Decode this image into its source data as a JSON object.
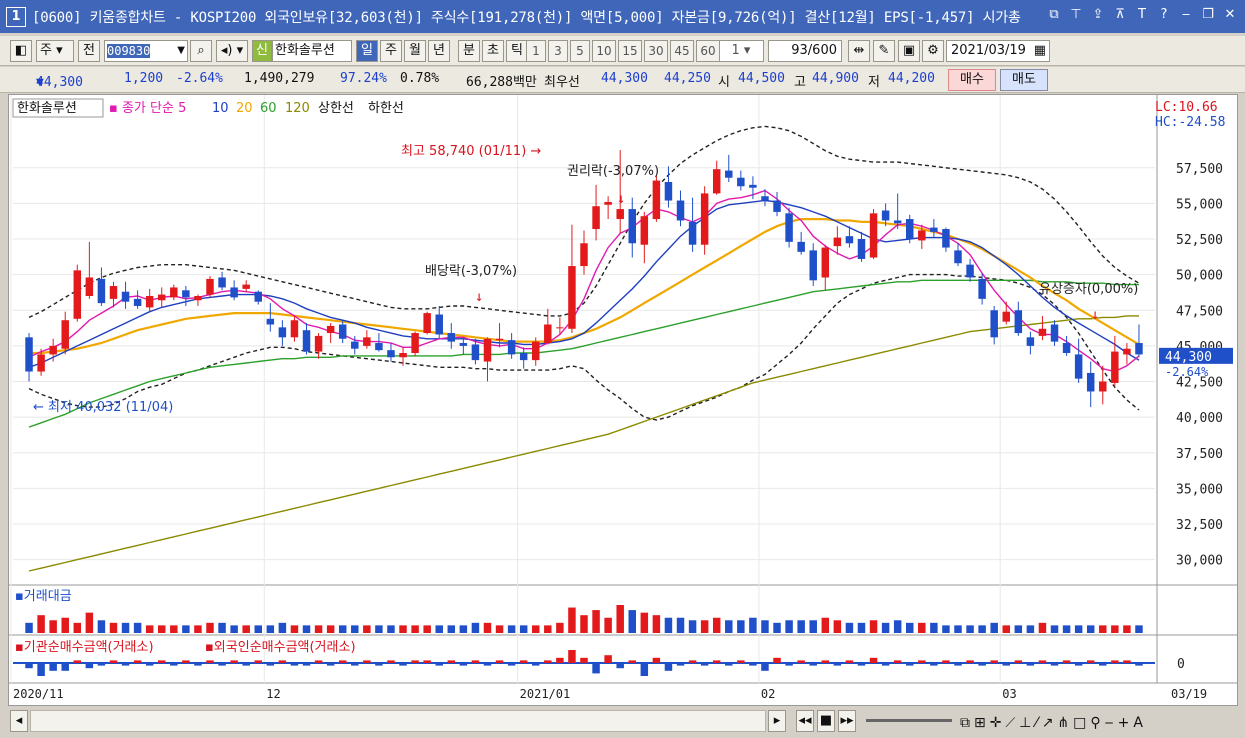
{
  "window": {
    "num": "1",
    "title": "[0600] 키움종합차트 - KOSPI200 외국인보유[32,603(천)] 주식수[191,278(천)] 액면[5,000] 자본금[9,726(억)] 결산[12월] EPS[-1,457] 시가총"
  },
  "toolbar": {
    "type1": "주",
    "type2": "전",
    "code": "009830",
    "name": "한화솔루션",
    "sin": "신",
    "periods": [
      "일",
      "주",
      "월",
      "년",
      "분",
      "초",
      "틱"
    ],
    "nums": [
      "1",
      "3",
      "5",
      "10",
      "15",
      "30",
      "45",
      "60"
    ],
    "unit": "1",
    "count": "93/600",
    "date": "2021/03/19"
  },
  "quote": {
    "price": "44,300",
    "arrow": "▼",
    "change": "1,200",
    "rate": "-2.64%",
    "volume": "1,490,279",
    "ratio": "97.24%",
    "turnover": "0.78%",
    "amount": "66,288백만",
    "best_label": "최우선",
    "ask": "44,300",
    "bid": "44,250",
    "open_label": "시",
    "open": "44,500",
    "high_label": "고",
    "high": "44,900",
    "low_label": "저",
    "low": "44,200",
    "buy": "매수",
    "sell": "매도"
  },
  "legend": {
    "name": "한화솔루션",
    "ma_label": "종가 단순",
    "ma": [
      "5",
      "10",
      "20",
      "60",
      "120"
    ],
    "upper": "상한선",
    "lower": "하한선"
  },
  "chart_data": {
    "type": "candlestick",
    "xlabels": [
      "2020/11",
      "12",
      "2021/01",
      "02",
      "03",
      "03/19"
    ],
    "yticks": [
      30000,
      32500,
      35000,
      37500,
      40000,
      42500,
      45000,
      47500,
      50000,
      52500,
      55000,
      57500
    ],
    "ylim": [
      28500,
      60500
    ],
    "lc": "LC:10.66",
    "hc": "HC:-24.58",
    "price_tag": "44,300",
    "rate_tag": "-2.64%",
    "annotations": {
      "high": "최고 58,740 (01/11)",
      "low": "최저 40,032 (11/04)",
      "div": "배당락(-3,07%)",
      "rights": "권리락(-3,07%)",
      "capinc": "유상증자(0,00%)"
    },
    "candles": [
      [
        45600,
        45900,
        42500,
        43200
      ],
      [
        43200,
        44800,
        42900,
        44400
      ],
      [
        44400,
        45500,
        43900,
        45000
      ],
      [
        44800,
        47400,
        44400,
        46800
      ],
      [
        46900,
        50700,
        46700,
        50300
      ],
      [
        48500,
        52300,
        48300,
        49800
      ],
      [
        49700,
        50500,
        47800,
        48000
      ],
      [
        48300,
        49500,
        47700,
        49200
      ],
      [
        48800,
        49500,
        47600,
        48100
      ],
      [
        48300,
        48900,
        47600,
        47800
      ],
      [
        47700,
        49000,
        47400,
        48500
      ],
      [
        48200,
        49100,
        47700,
        48600
      ],
      [
        48400,
        49300,
        48200,
        49100
      ],
      [
        48900,
        49200,
        47800,
        48400
      ],
      [
        48200,
        48600,
        47800,
        48500
      ],
      [
        48600,
        49900,
        48400,
        49700
      ],
      [
        49800,
        50200,
        48900,
        49100
      ],
      [
        49100,
        49600,
        48200,
        48400
      ],
      [
        49000,
        49600,
        48800,
        49300
      ],
      [
        48800,
        48900,
        47900,
        48100
      ],
      [
        46900,
        48000,
        46000,
        46500
      ],
      [
        46300,
        46800,
        45000,
        45600
      ],
      [
        45600,
        47100,
        45300,
        46800
      ],
      [
        46100,
        46600,
        44400,
        44600
      ],
      [
        44600,
        45900,
        44100,
        45700
      ],
      [
        45900,
        46600,
        45200,
        46400
      ],
      [
        46500,
        46800,
        45200,
        45500
      ],
      [
        45300,
        45700,
        44400,
        44800
      ],
      [
        45000,
        46100,
        44800,
        45600
      ],
      [
        45200,
        45900,
        44600,
        44700
      ],
      [
        44700,
        45200,
        43900,
        44200
      ],
      [
        44200,
        44900,
        43600,
        44500
      ],
      [
        44500,
        46000,
        44300,
        45900
      ],
      [
        45900,
        47400,
        45800,
        47300
      ],
      [
        47200,
        47800,
        45500,
        45800
      ],
      [
        45900,
        46600,
        44800,
        45300
      ],
      [
        45200,
        45600,
        44400,
        45000
      ],
      [
        45100,
        45500,
        43700,
        44000
      ],
      [
        43900,
        45600,
        42500,
        45500
      ],
      [
        45400,
        46600,
        44900,
        45500
      ],
      [
        45400,
        45900,
        44100,
        44400
      ],
      [
        44500,
        44900,
        43400,
        44000
      ],
      [
        44000,
        45600,
        43600,
        45300
      ],
      [
        45200,
        47600,
        45100,
        46500
      ],
      [
        46300,
        47000,
        45800,
        46300
      ],
      [
        46200,
        53500,
        45900,
        50600
      ],
      [
        50600,
        53100,
        50000,
        52200
      ],
      [
        53200,
        56300,
        52400,
        54800
      ],
      [
        54900,
        55500,
        53900,
        55100
      ],
      [
        53900,
        58740,
        52900,
        54600
      ],
      [
        54600,
        55400,
        51200,
        52200
      ],
      [
        52100,
        54400,
        50800,
        54100
      ],
      [
        53900,
        57000,
        53700,
        56600
      ],
      [
        56500,
        57600,
        54700,
        55200
      ],
      [
        55200,
        55900,
        53400,
        53800
      ],
      [
        53700,
        55400,
        51600,
        52100
      ],
      [
        52100,
        56200,
        51400,
        55700
      ],
      [
        55700,
        58000,
        55600,
        57400
      ],
      [
        57300,
        58400,
        56500,
        56800
      ],
      [
        56800,
        57300,
        55900,
        56200
      ],
      [
        56300,
        56900,
        55300,
        56100
      ],
      [
        55500,
        56000,
        54800,
        55200
      ],
      [
        55200,
        55800,
        54100,
        54400
      ],
      [
        54300,
        54700,
        51900,
        52300
      ],
      [
        52300,
        53000,
        51400,
        51600
      ],
      [
        51700,
        52200,
        49200,
        49600
      ],
      [
        49800,
        52100,
        48900,
        51900
      ],
      [
        52000,
        53400,
        51400,
        52600
      ],
      [
        52700,
        53400,
        51900,
        52200
      ],
      [
        52500,
        53000,
        50900,
        51100
      ],
      [
        51200,
        54600,
        51100,
        54300
      ],
      [
        54500,
        55000,
        53400,
        53800
      ],
      [
        53800,
        55700,
        53200,
        53600
      ],
      [
        53900,
        54200,
        52200,
        52500
      ],
      [
        52400,
        53500,
        51800,
        53100
      ],
      [
        53300,
        53900,
        52600,
        53000
      ],
      [
        53200,
        53300,
        51600,
        51900
      ],
      [
        51700,
        52200,
        50600,
        50800
      ],
      [
        50700,
        51100,
        49500,
        49800
      ],
      [
        49700,
        50100,
        47900,
        48300
      ],
      [
        47500,
        47800,
        45100,
        45600
      ],
      [
        46700,
        48100,
        46500,
        47400
      ],
      [
        47500,
        48100,
        45700,
        45900
      ],
      [
        45600,
        46000,
        44400,
        45000
      ],
      [
        45700,
        47100,
        45400,
        46200
      ],
      [
        46500,
        46800,
        45000,
        45300
      ],
      [
        45200,
        45700,
        44300,
        44500
      ],
      [
        44400,
        45500,
        42400,
        42700
      ],
      [
        43100,
        43900,
        40700,
        41800
      ],
      [
        41800,
        43600,
        40900,
        42500
      ],
      [
        42400,
        45700,
        42200,
        44600
      ],
      [
        44400,
        45200,
        43700,
        44800
      ],
      [
        45200,
        46500,
        44200,
        44400
      ]
    ],
    "ma5": [
      44200,
      44600,
      44900,
      45300,
      46000,
      46800,
      47300,
      47800,
      48400,
      48500,
      48200,
      48400,
      48500,
      48300,
      48400,
      48600,
      48800,
      48900,
      48800,
      48700,
      48300,
      47600,
      47100,
      46500,
      46300,
      46000,
      45800,
      45400,
      45300,
      45300,
      45200,
      44900,
      44900,
      45200,
      45500,
      45600,
      45600,
      45300,
      45100,
      45000,
      45100,
      44800,
      44800,
      45200,
      45800,
      46800,
      48300,
      50300,
      51900,
      52900,
      53300,
      54000,
      54600,
      54400,
      54000,
      53700,
      54100,
      55000,
      55300,
      55400,
      55600,
      55900,
      55300,
      54500,
      53800,
      52700,
      52000,
      51500,
      51100,
      51400,
      52000,
      52800,
      53500,
      53600,
      53400,
      53100,
      52700,
      52200,
      51400,
      50100,
      48900,
      47900,
      47000,
      46200,
      45800,
      45800,
      45300,
      44700,
      44100,
      43400,
      43200,
      43600,
      44300
    ],
    "ma10": [
      43500,
      43800,
      44200,
      44600,
      45000,
      45400,
      45800,
      46200,
      46600,
      47000,
      47400,
      47700,
      47900,
      48100,
      48300,
      48400,
      48500,
      48600,
      48600,
      48600,
      48500,
      48300,
      48000,
      47600,
      47300,
      47000,
      46800,
      46600,
      46300,
      46100,
      45900,
      45700,
      45600,
      45500,
      45500,
      45500,
      45500,
      45400,
      45300,
      45200,
      45200,
      45100,
      45100,
      45200,
      45300,
      45500,
      45900,
      46600,
      47400,
      48200,
      49000,
      49900,
      50900,
      51800,
      52700,
      53400,
      54000,
      54600,
      54900,
      55000,
      55100,
      55200,
      55100,
      54900,
      54700,
      54400,
      54100,
      53700,
      53300,
      52900,
      52500,
      52300,
      52400,
      52500,
      52600,
      52600,
      52600,
      52500,
      52300,
      51900,
      51300,
      50700,
      50000,
      49200,
      48400,
      47700,
      47100,
      46600,
      46100,
      45600,
      45100,
      44500,
      44000
    ],
    "ma20": [
      44500,
      44500,
      44600,
      44700,
      44800,
      45000,
      45200,
      45500,
      45800,
      46100,
      46300,
      46500,
      46700,
      46900,
      47000,
      47100,
      47200,
      47300,
      47300,
      47300,
      47300,
      47200,
      47100,
      47000,
      46900,
      46800,
      46700,
      46600,
      46500,
      46400,
      46300,
      46200,
      46100,
      46000,
      45900,
      45800,
      45700,
      45600,
      45500,
      45400,
      45300,
      45300,
      45300,
      45300,
      45400,
      45600,
      45900,
      46200,
      46600,
      47000,
      47500,
      48000,
      48500,
      49000,
      49500,
      50000,
      50500,
      51000,
      51500,
      52000,
      52500,
      53000,
      53400,
      53700,
      53900,
      53900,
      53900,
      53800,
      53800,
      53700,
      53700,
      53600,
      53500,
      53400,
      53200,
      53000,
      52800,
      52500,
      52200,
      51800,
      51300,
      50800,
      50300,
      49800,
      49200,
      48700,
      48200,
      47600,
      47100,
      46600,
      46100,
      45600,
      45100
    ],
    "ma60": [
      39300,
      39600,
      39900,
      40200,
      40600,
      41000,
      41300,
      41600,
      41900,
      42200,
      42500,
      42700,
      42900,
      43100,
      43300,
      43500,
      43600,
      43700,
      43800,
      43900,
      44000,
      44100,
      44100,
      44200,
      44200,
      44200,
      44300,
      44300,
      44300,
      44300,
      44300,
      44300,
      44300,
      44300,
      44300,
      44300,
      44400,
      44400,
      44400,
      44400,
      44500,
      44500,
      44500,
      44600,
      44700,
      44800,
      45000,
      45200,
      45400,
      45600,
      45800,
      46000,
      46200,
      46400,
      46600,
      46800,
      47000,
      47200,
      47400,
      47600,
      47800,
      48000,
      48200,
      48400,
      48600,
      48800,
      48900,
      49000,
      49100,
      49200,
      49300,
      49400,
      49500,
      49500,
      49600,
      49600,
      49600,
      49600,
      49600,
      49600,
      49600,
      49600,
      49600,
      49600,
      49500,
      49500,
      49500,
      49400,
      49400,
      49400,
      49300,
      49300,
      49300
    ],
    "ma120": [
      29200,
      29400,
      29600,
      29800,
      30000,
      30200,
      30400,
      30600,
      30800,
      31000,
      31200,
      31400,
      31600,
      31800,
      32000,
      32200,
      32400,
      32600,
      32800,
      33000,
      33200,
      33400,
      33600,
      33800,
      34000,
      34200,
      34400,
      34600,
      34800,
      35000,
      35200,
      35400,
      35600,
      35800,
      36000,
      36200,
      36400,
      36600,
      36800,
      37000,
      37200,
      37400,
      37600,
      37800,
      38000,
      38200,
      38400,
      38600,
      38800,
      39100,
      39400,
      39700,
      40000,
      40300,
      40600,
      40900,
      41200,
      41500,
      41800,
      42100,
      42400,
      42600,
      42800,
      43000,
      43200,
      43400,
      43600,
      43800,
      44000,
      44200,
      44400,
      44600,
      44800,
      45000,
      45200,
      45400,
      45600,
      45800,
      46000,
      46100,
      46200,
      46300,
      46400,
      46500,
      46600,
      46700,
      46800,
      46900,
      46900,
      47000,
      47000,
      47100,
      47100
    ],
    "upper": [
      47000,
      47400,
      47900,
      48400,
      48900,
      49400,
      49800,
      50100,
      50300,
      50500,
      50600,
      50700,
      50700,
      50700,
      50600,
      50500,
      50400,
      50300,
      50100,
      49900,
      49700,
      49500,
      49300,
      49100,
      48900,
      48700,
      48500,
      48300,
      48100,
      47900,
      47700,
      47600,
      47600,
      47600,
      47700,
      47800,
      47800,
      47700,
      47600,
      47500,
      47400,
      47300,
      47200,
      47100,
      47100,
      47300,
      48000,
      49200,
      50700,
      52200,
      53700,
      55000,
      56100,
      57000,
      57800,
      58400,
      58900,
      59400,
      59800,
      60100,
      60300,
      60400,
      60300,
      60100,
      59700,
      59200,
      58700,
      58300,
      58100,
      58000,
      57900,
      57900,
      57900,
      57800,
      57700,
      57600,
      57500,
      57400,
      57300,
      57200,
      57100,
      57000,
      56800,
      56500,
      56000,
      55300,
      54400,
      53400,
      52300,
      51300,
      50500,
      49900,
      49400
    ],
    "lower": [
      42000,
      41600,
      41300,
      41000,
      40800,
      40700,
      40700,
      40900,
      41300,
      41800,
      42100,
      42300,
      42700,
      43100,
      43300,
      43600,
      43900,
      44200,
      44500,
      44700,
      44900,
      44900,
      44800,
      44600,
      44500,
      44400,
      44300,
      44200,
      44100,
      44000,
      43900,
      43800,
      43700,
      43600,
      43500,
      43500,
      43500,
      43400,
      43400,
      43300,
      43300,
      43300,
      43300,
      43300,
      43400,
      43600,
      43400,
      42600,
      41900,
      41300,
      40600,
      40000,
      39800,
      40000,
      40400,
      40800,
      41100,
      41400,
      41800,
      42100,
      42600,
      43000,
      43700,
      44400,
      45200,
      46200,
      47100,
      48000,
      48600,
      49000,
      49400,
      49600,
      49800,
      50000,
      50000,
      50000,
      50000,
      49900,
      49900,
      49800,
      49700,
      49600,
      49400,
      49100,
      48600,
      47900,
      47000,
      45900,
      44600,
      43300,
      42100,
      41200,
      40500
    ]
  },
  "vol_panel": {
    "label": "거래대금",
    "values": [
      4,
      7,
      5,
      6,
      4,
      8,
      5,
      4,
      4,
      4,
      3,
      3,
      3,
      3,
      3,
      4,
      4,
      3,
      3,
      3,
      3,
      4,
      3,
      3,
      3,
      3,
      3,
      3,
      3,
      3,
      3,
      3,
      3,
      3,
      3,
      3,
      3,
      4,
      4,
      3,
      3,
      3,
      3,
      3,
      4,
      10,
      7,
      9,
      6,
      11,
      9,
      8,
      7,
      6,
      6,
      5,
      5,
      6,
      5,
      5,
      6,
      5,
      4,
      5,
      5,
      5,
      6,
      5,
      4,
      4,
      5,
      4,
      5,
      4,
      4,
      4,
      3,
      3,
      3,
      3,
      4,
      3,
      3,
      3,
      4,
      3,
      3,
      3,
      3,
      3,
      3,
      3,
      3
    ]
  },
  "flow_panel": {
    "label1": "기관순매수금액(거래소)",
    "label2": "외국인순매수금액(거래소)",
    "zero": "0",
    "values": [
      -2,
      -5,
      -3,
      -3,
      1,
      -2,
      -1,
      1,
      -1,
      1,
      -1,
      1,
      -1,
      1,
      -1,
      1,
      -1,
      1,
      -1,
      1,
      -1,
      1,
      -1,
      -1,
      1,
      -1,
      1,
      -1,
      1,
      -1,
      1,
      -1,
      1,
      1,
      -1,
      1,
      -1,
      1,
      -1,
      1,
      -1,
      1,
      -1,
      1,
      2,
      5,
      2,
      -4,
      3,
      -2,
      1,
      -5,
      2,
      -3,
      -1,
      1,
      -1,
      1,
      -1,
      1,
      -1,
      -3,
      2,
      -1,
      1,
      -1,
      1,
      -1,
      1,
      -1,
      2,
      -1,
      1,
      -1,
      1,
      -1,
      1,
      -1,
      1,
      -1,
      1,
      -1,
      1,
      -1,
      1,
      -1,
      1,
      -1,
      1,
      -1,
      1,
      1,
      -1
    ]
  },
  "colors": {
    "up": "#e31a1c",
    "down": "#1f4fc9",
    "ma5": "#e01ab0",
    "ma10": "#1f3fbf",
    "ma20": "#f0a800",
    "ma60": "#2ca02c",
    "ma120": "#8a8a00",
    "title": "#3f66b9"
  }
}
